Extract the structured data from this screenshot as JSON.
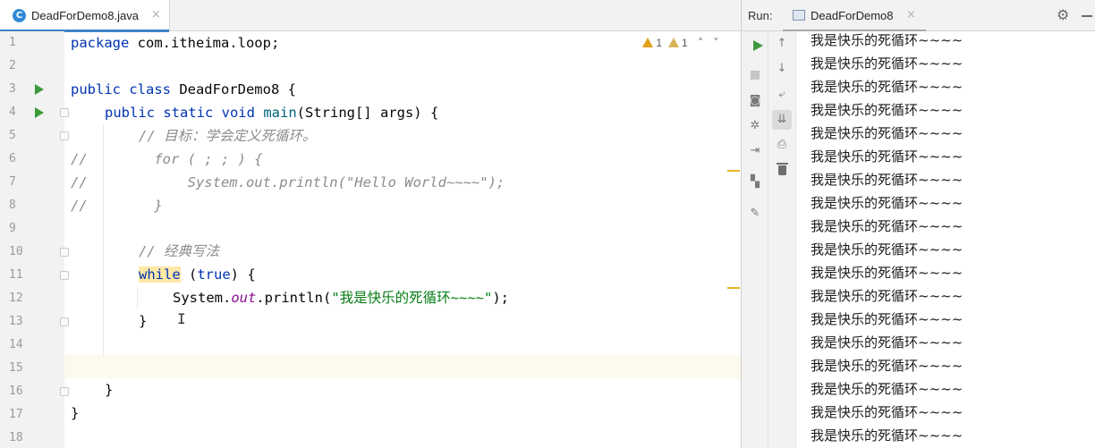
{
  "editor": {
    "tab": {
      "filename": "DeadForDemo8.java",
      "icon": "C",
      "close": "×"
    },
    "warnings": {
      "strong_count": "1",
      "weak_count": "1"
    },
    "line_numbers": [
      "1",
      "2",
      "3",
      "4",
      "5",
      "6",
      "7",
      "8",
      "9",
      "10",
      "11",
      "12",
      "13",
      "14",
      "15",
      "16",
      "17",
      "18"
    ],
    "code": {
      "l1_kw": "package",
      "l1_rest": " com.itheima.loop;",
      "l3_kw": "public class",
      "l3_rest": " DeadForDemo8 {",
      "l4_kw": "public static void",
      "l4_fn": "main",
      "l4_rest": "(String[] args) {",
      "l5_comment": "// 目标：学会定义死循环。",
      "l6_comment": "//        for ( ; ; ) {",
      "l7_comment": "//            System.out.println(\"Hello World~~~~\");",
      "l8_comment": "//        }",
      "l10_comment": "// 经典写法",
      "l11_kw": "while",
      "l11_mid": " (",
      "l11_kw2": "true",
      "l11_end": ") {",
      "l12_a": "System.",
      "l12_field": "out",
      "l12_b": ".println(",
      "l12_str": "\"我是快乐的死循环~~~~\"",
      "l12_c": ");",
      "l13": "}",
      "l16": "}",
      "l17": "}"
    }
  },
  "run": {
    "label": "Run:",
    "tab": {
      "name": "DeadForDemo8",
      "close": "×"
    },
    "output_lines": [
      "我是快乐的死循环~~~~",
      "我是快乐的死循环~~~~",
      "我是快乐的死循环~~~~",
      "我是快乐的死循环~~~~",
      "我是快乐的死循环~~~~",
      "我是快乐的死循环~~~~",
      "我是快乐的死循环~~~~",
      "我是快乐的死循环~~~~",
      "我是快乐的死循环~~~~",
      "我是快乐的死循环~~~~",
      "我是快乐的死循环~~~~",
      "我是快乐的死循环~~~~",
      "我是快乐的死循环~~~~",
      "我是快乐的死循环~~~~",
      "我是快乐的死循环~~~~",
      "我是快乐的死循环~~~~",
      "我是快乐的死循环~~~~",
      "我是快乐的死循环~~~~"
    ]
  }
}
